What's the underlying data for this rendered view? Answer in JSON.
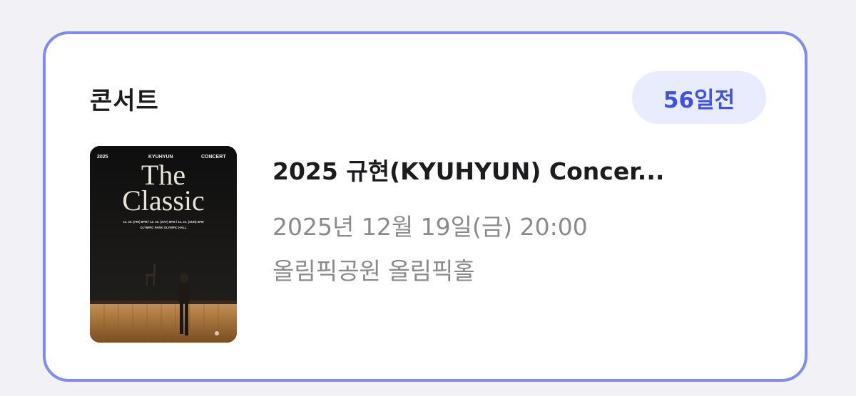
{
  "card": {
    "category": "콘서트",
    "dday": "56일전",
    "title": "2025 규현(KYUHYUN) Concer...",
    "datetime": "2025년 12월 19일(금) 20:00",
    "venue": "올림픽공원 올림픽홀"
  },
  "poster": {
    "year": "2025",
    "artist": "KYUHYUN",
    "kind": "CONCERT",
    "title_line1": "The",
    "title_line2": "Classic",
    "schedule": "12. 19. (FRI) 8PM / 12. 20. (SAT) 6PM / 12. 21. (SUN) 5PM",
    "place": "OLYMPIC PARK OLYMPIC HALL"
  },
  "colors": {
    "accent": "#3f52e8",
    "card_border": "#7e8bf2",
    "badge_bg": "#e9ecfd",
    "muted_text": "#8a8a8e"
  }
}
